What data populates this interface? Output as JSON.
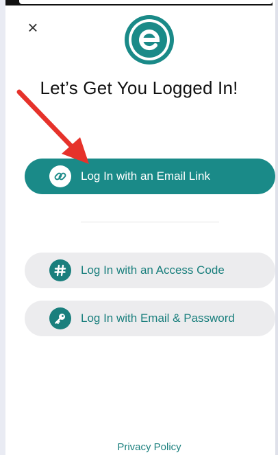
{
  "modal": {
    "close_label": "×",
    "title": "Let’s Get You Logged In!",
    "buttons": {
      "email_link": "Log In with an Email Link",
      "access_code": "Log In with an Access Code",
      "email_password": "Log In with Email & Password"
    },
    "privacy_policy": "Privacy Policy"
  },
  "icons": {
    "close": "close-icon",
    "logo": "e-logo-icon",
    "email_link": "link-icon",
    "access_code": "hash-icon",
    "email_password": "key-icon",
    "annotation": "red-arrow-icon"
  },
  "colors": {
    "brand": "#1a8a88",
    "secondary_bg": "#ececee",
    "annotation": "#e6322b"
  }
}
